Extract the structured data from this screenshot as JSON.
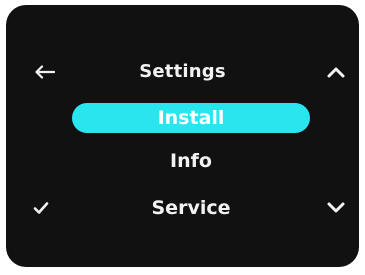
{
  "screen": {
    "title": "Settings",
    "menu_items": [
      {
        "label": "Install",
        "selected": true
      },
      {
        "label": "Info",
        "selected": false
      },
      {
        "label": "Service",
        "selected": false
      }
    ]
  },
  "buttons": {
    "back_icon": "left-arrow-icon",
    "up_icon": "chevron-up-icon",
    "confirm_icon": "check-icon",
    "down_icon": "chevron-down-icon"
  },
  "colors": {
    "background": "#111111",
    "highlight": "#29e6ee",
    "text": "#f2f2f2"
  }
}
